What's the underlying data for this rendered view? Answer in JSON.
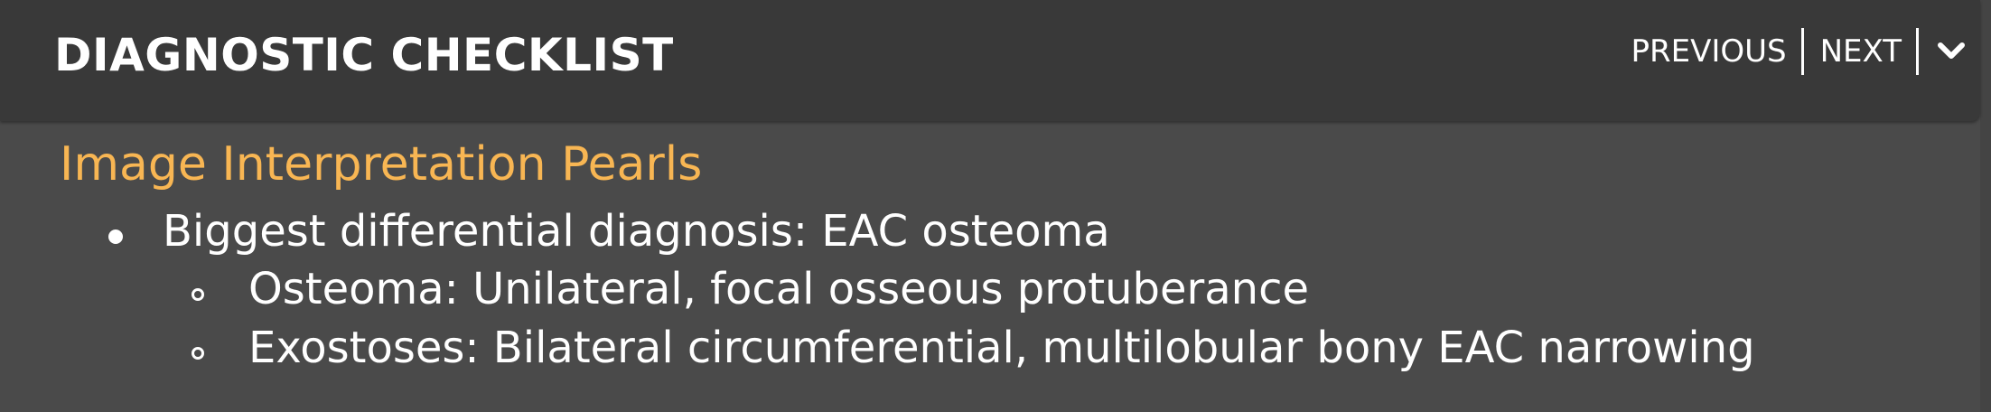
{
  "header": {
    "title": "DIAGNOSTIC CHECKLIST",
    "nav": {
      "previous_label": "PREVIOUS",
      "next_label": "NEXT",
      "toggle_icon": "chevron-down-icon"
    }
  },
  "section": {
    "title": "Image Interpretation Pearls",
    "items": [
      {
        "text": "Biggest differential diagnosis: EAC osteoma",
        "children": [
          {
            "text": "Osteoma: Unilateral, focal osseous protuberance"
          },
          {
            "text": "Exostoses: Bilateral circumferential, multilobular bony EAC narrowing"
          }
        ]
      }
    ]
  },
  "colors": {
    "header_bg": "#393939",
    "content_bg": "#4a4a4a",
    "section_title": "#f8b653",
    "text": "#ffffff"
  }
}
